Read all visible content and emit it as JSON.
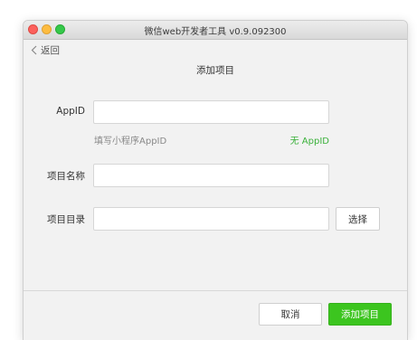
{
  "window": {
    "title": "微信web开发者工具 v0.9.092300"
  },
  "nav": {
    "back_label": "返回"
  },
  "page": {
    "title": "添加项目"
  },
  "form": {
    "appid": {
      "label": "AppID",
      "value": "",
      "hint": "填写小程序AppID",
      "no_appid_link": "无 AppID"
    },
    "project_name": {
      "label": "项目名称",
      "value": ""
    },
    "project_dir": {
      "label": "项目目录",
      "value": "",
      "choose_label": "选择"
    }
  },
  "footer": {
    "cancel_label": "取消",
    "add_label": "添加项目"
  },
  "colors": {
    "accent_green": "#3cc51f",
    "link_green": "#3bb13b"
  }
}
